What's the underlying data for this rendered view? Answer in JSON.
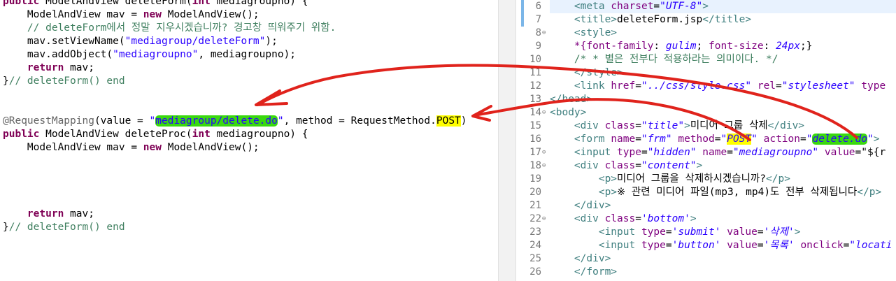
{
  "left": {
    "lines": [
      {
        "parts": [
          {
            "c": "kw",
            "t": "public "
          },
          {
            "t": "ModelAndView deleteForm("
          },
          {
            "c": "kw",
            "t": "int "
          },
          {
            "t": "mediagroupno) {"
          }
        ]
      },
      {
        "parts": [
          {
            "t": "    ModelAndView mav = "
          },
          {
            "c": "kw",
            "t": "new "
          },
          {
            "t": "ModelAndView();"
          }
        ]
      },
      {
        "parts": [
          {
            "c": "cmt",
            "t": "    // deleteForm에서 정말 지우시겠습니까? 경고창 띄워주기 위함."
          }
        ]
      },
      {
        "parts": [
          {
            "t": "    mav.setViewName("
          },
          {
            "c": "str",
            "t": "\"mediagroup/deleteForm\""
          },
          {
            "t": ");"
          }
        ]
      },
      {
        "parts": [
          {
            "t": "    mav.addObject("
          },
          {
            "c": "str",
            "t": "\"mediagroupno\""
          },
          {
            "t": ", mediagroupno);"
          }
        ]
      },
      {
        "parts": [
          {
            "c": "kw",
            "t": "    return "
          },
          {
            "t": "mav;"
          }
        ]
      },
      {
        "parts": [
          {
            "t": "}"
          },
          {
            "c": "cmt",
            "t": "// deleteForm() end"
          }
        ]
      },
      {
        "parts": []
      },
      {
        "parts": []
      },
      {
        "parts": [
          {
            "c": "ann",
            "t": "@RequestMapping"
          },
          {
            "t": "(value = "
          },
          {
            "c": "str",
            "t": "\""
          },
          {
            "c": "str hl-green",
            "t": "mediagroup/delete.do"
          },
          {
            "c": "str",
            "t": "\""
          },
          {
            "t": ", method = RequestMethod."
          },
          {
            "c": "hl-yellow",
            "t": "POST"
          },
          {
            "t": ")"
          }
        ]
      },
      {
        "parts": [
          {
            "c": "kw",
            "t": "public "
          },
          {
            "t": "ModelAndView deleteProc("
          },
          {
            "c": "kw",
            "t": "int "
          },
          {
            "t": "mediagroupno) {"
          }
        ]
      },
      {
        "parts": [
          {
            "t": "    ModelAndView mav = "
          },
          {
            "c": "kw",
            "t": "new "
          },
          {
            "t": "ModelAndView();"
          }
        ]
      },
      {
        "parts": []
      },
      {
        "parts": []
      },
      {
        "parts": []
      },
      {
        "parts": []
      },
      {
        "parts": [
          {
            "c": "kw",
            "t": "    return "
          },
          {
            "t": "mav;"
          }
        ]
      },
      {
        "parts": [
          {
            "t": "}"
          },
          {
            "c": "cmt",
            "t": "// deleteForm() end"
          }
        ]
      }
    ]
  },
  "right": {
    "line_numbers": [
      "6",
      "7",
      "8",
      "9",
      "10",
      "11",
      "12",
      "13",
      "14",
      "15",
      "16",
      "17",
      "18",
      "19",
      "20",
      "21",
      "22",
      "23",
      "24",
      "25",
      "26"
    ],
    "fold_markers": [
      "",
      "",
      "⊖",
      "",
      "",
      "",
      "",
      "",
      "⊖",
      "",
      "",
      "⊖",
      "⊖",
      "",
      "",
      "",
      "⊖",
      "",
      "",
      "",
      ""
    ],
    "lines": [
      {
        "parts": [
          {
            "t": "    "
          },
          {
            "c": "tag",
            "t": "<meta "
          },
          {
            "c": "attr",
            "t": "charset"
          },
          {
            "t": "="
          },
          {
            "c": "aval",
            "t": "\"UTF-8\""
          },
          {
            "c": "tag",
            "t": ">"
          }
        ]
      },
      {
        "parts": [
          {
            "t": "    "
          },
          {
            "c": "tag",
            "t": "<title>"
          },
          {
            "t": "deleteForm.jsp"
          },
          {
            "c": "tag",
            "t": "</title>"
          }
        ]
      },
      {
        "parts": [
          {
            "t": "    "
          },
          {
            "c": "tag",
            "t": "<style>"
          }
        ]
      },
      {
        "parts": [
          {
            "t": "    "
          },
          {
            "c": "css-prop",
            "t": "*{font-family"
          },
          {
            "t": ": "
          },
          {
            "c": "css-val",
            "t": "gulim"
          },
          {
            "t": "; "
          },
          {
            "c": "css-prop",
            "t": "font-size"
          },
          {
            "t": ": "
          },
          {
            "c": "css-val",
            "t": "24px"
          },
          {
            "t": ";}"
          }
        ]
      },
      {
        "parts": [
          {
            "t": "    "
          },
          {
            "c": "cmt",
            "t": "/* * 별은 전부다 적용하라는 의미이다. */"
          }
        ]
      },
      {
        "parts": [
          {
            "t": "    "
          },
          {
            "c": "tag",
            "t": "</style>"
          }
        ]
      },
      {
        "parts": [
          {
            "t": "    "
          },
          {
            "c": "tag",
            "t": "<link "
          },
          {
            "c": "attr",
            "t": "href"
          },
          {
            "t": "="
          },
          {
            "c": "aval",
            "t": "\"../css/style.css\""
          },
          {
            "t": " "
          },
          {
            "c": "attr",
            "t": "rel"
          },
          {
            "t": "="
          },
          {
            "c": "aval",
            "t": "\"stylesheet\""
          },
          {
            "t": " "
          },
          {
            "c": "attr",
            "t": "type"
          }
        ]
      },
      {
        "parts": [
          {
            "c": "tag",
            "t": "</head>"
          }
        ]
      },
      {
        "parts": [
          {
            "c": "tag",
            "t": "<body>"
          }
        ]
      },
      {
        "parts": [
          {
            "t": "    "
          },
          {
            "c": "tag",
            "t": "<div "
          },
          {
            "c": "attr",
            "t": "class"
          },
          {
            "t": "="
          },
          {
            "c": "aval",
            "t": "\"title\""
          },
          {
            "c": "tag",
            "t": ">"
          },
          {
            "t": "미디어 그룹 삭제"
          },
          {
            "c": "tag",
            "t": "</div>"
          }
        ]
      },
      {
        "parts": [
          {
            "t": "    "
          },
          {
            "c": "tag",
            "t": "<form "
          },
          {
            "c": "attr",
            "t": "name"
          },
          {
            "t": "="
          },
          {
            "c": "aval",
            "t": "\"frm\""
          },
          {
            "t": " "
          },
          {
            "c": "attr",
            "t": "method"
          },
          {
            "t": "="
          },
          {
            "c": "aval",
            "t": "\""
          },
          {
            "c": "aval hl-yellow",
            "t": "POST"
          },
          {
            "c": "aval",
            "t": "\""
          },
          {
            "t": " "
          },
          {
            "c": "attr",
            "t": "action"
          },
          {
            "t": "="
          },
          {
            "c": "aval",
            "t": "\""
          },
          {
            "c": "aval hl-green",
            "t": "delete.do"
          },
          {
            "c": "aval",
            "t": "\""
          },
          {
            "c": "tag",
            "t": ">"
          }
        ]
      },
      {
        "parts": [
          {
            "t": "    "
          },
          {
            "c": "tag",
            "t": "<input "
          },
          {
            "c": "attr",
            "t": "type"
          },
          {
            "t": "="
          },
          {
            "c": "aval",
            "t": "\"hidden\""
          },
          {
            "t": " "
          },
          {
            "c": "attr",
            "t": "name"
          },
          {
            "t": "="
          },
          {
            "c": "aval",
            "t": "\"mediagroupno\""
          },
          {
            "t": " "
          },
          {
            "c": "attr",
            "t": "value"
          },
          {
            "t": "=\"${r"
          }
        ]
      },
      {
        "parts": [
          {
            "t": "    "
          },
          {
            "c": "tag",
            "t": "<div "
          },
          {
            "c": "attr",
            "t": "class"
          },
          {
            "t": "="
          },
          {
            "c": "aval",
            "t": "\"content\""
          },
          {
            "c": "tag",
            "t": ">"
          }
        ]
      },
      {
        "parts": [
          {
            "t": "        "
          },
          {
            "c": "tag",
            "t": "<p>"
          },
          {
            "t": "미디어 그룹을 삭제하시겠습니까?"
          },
          {
            "c": "tag",
            "t": "</p>"
          }
        ]
      },
      {
        "parts": [
          {
            "t": "        "
          },
          {
            "c": "tag",
            "t": "<p>"
          },
          {
            "t": "※ 관련 미디어 파일(mp3, mp4)도 전부 삭제됩니다"
          },
          {
            "c": "tag",
            "t": "</p>"
          }
        ]
      },
      {
        "parts": [
          {
            "t": "    "
          },
          {
            "c": "tag",
            "t": "</div>"
          }
        ]
      },
      {
        "parts": [
          {
            "t": "    "
          },
          {
            "c": "tag",
            "t": "<div "
          },
          {
            "c": "attr",
            "t": "class"
          },
          {
            "t": "="
          },
          {
            "c": "aval",
            "t": "'bottom'"
          },
          {
            "c": "tag",
            "t": ">"
          }
        ]
      },
      {
        "parts": [
          {
            "t": "        "
          },
          {
            "c": "tag",
            "t": "<input "
          },
          {
            "c": "attr",
            "t": "type"
          },
          {
            "t": "="
          },
          {
            "c": "aval",
            "t": "'submit'"
          },
          {
            "t": " "
          },
          {
            "c": "attr",
            "t": "value"
          },
          {
            "t": "="
          },
          {
            "c": "aval",
            "t": "'삭제'"
          },
          {
            "c": "tag",
            "t": ">"
          }
        ]
      },
      {
        "parts": [
          {
            "t": "        "
          },
          {
            "c": "tag",
            "t": "<input "
          },
          {
            "c": "attr",
            "t": "type"
          },
          {
            "t": "="
          },
          {
            "c": "aval",
            "t": "'button'"
          },
          {
            "t": " "
          },
          {
            "c": "attr",
            "t": "value"
          },
          {
            "t": "="
          },
          {
            "c": "aval",
            "t": "'목록'"
          },
          {
            "t": " "
          },
          {
            "c": "attr",
            "t": "onclick"
          },
          {
            "t": "="
          },
          {
            "c": "aval",
            "t": "\"locati"
          }
        ]
      },
      {
        "parts": [
          {
            "t": "    "
          },
          {
            "c": "tag",
            "t": "</div>"
          }
        ]
      },
      {
        "parts": [
          {
            "t": "    "
          },
          {
            "c": "tag",
            "t": "</form>"
          }
        ]
      }
    ]
  },
  "annotation_color": "#e0231c"
}
